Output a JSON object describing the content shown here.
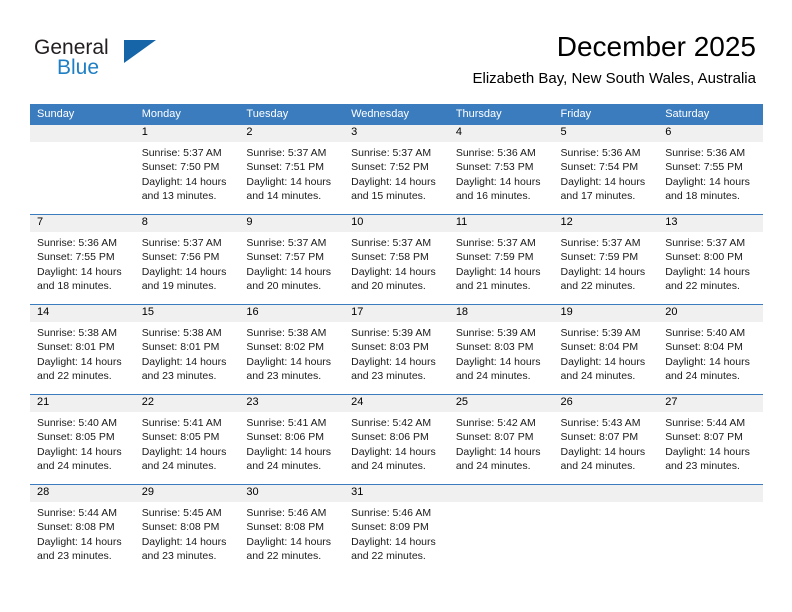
{
  "logo": {
    "word_top": "General",
    "word_bottom": "Blue",
    "triangle_color": "#1565a8",
    "blue_color": "#1f7fc4"
  },
  "header": {
    "title": "December 2025",
    "subtitle": "Elizabeth Bay, New South Wales, Australia"
  },
  "theme": {
    "header_blue": "#3b7cbf",
    "daynum_band": "#f0f0f0"
  },
  "weekdays": [
    "Sunday",
    "Monday",
    "Tuesday",
    "Wednesday",
    "Thursday",
    "Friday",
    "Saturday"
  ],
  "weeks": [
    [
      {
        "day": "",
        "lines": []
      },
      {
        "day": "1",
        "lines": [
          "Sunrise: 5:37 AM",
          "Sunset: 7:50 PM",
          "Daylight: 14 hours",
          "and 13 minutes."
        ]
      },
      {
        "day": "2",
        "lines": [
          "Sunrise: 5:37 AM",
          "Sunset: 7:51 PM",
          "Daylight: 14 hours",
          "and 14 minutes."
        ]
      },
      {
        "day": "3",
        "lines": [
          "Sunrise: 5:37 AM",
          "Sunset: 7:52 PM",
          "Daylight: 14 hours",
          "and 15 minutes."
        ]
      },
      {
        "day": "4",
        "lines": [
          "Sunrise: 5:36 AM",
          "Sunset: 7:53 PM",
          "Daylight: 14 hours",
          "and 16 minutes."
        ]
      },
      {
        "day": "5",
        "lines": [
          "Sunrise: 5:36 AM",
          "Sunset: 7:54 PM",
          "Daylight: 14 hours",
          "and 17 minutes."
        ]
      },
      {
        "day": "6",
        "lines": [
          "Sunrise: 5:36 AM",
          "Sunset: 7:55 PM",
          "Daylight: 14 hours",
          "and 18 minutes."
        ]
      }
    ],
    [
      {
        "day": "7",
        "lines": [
          "Sunrise: 5:36 AM",
          "Sunset: 7:55 PM",
          "Daylight: 14 hours",
          "and 18 minutes."
        ]
      },
      {
        "day": "8",
        "lines": [
          "Sunrise: 5:37 AM",
          "Sunset: 7:56 PM",
          "Daylight: 14 hours",
          "and 19 minutes."
        ]
      },
      {
        "day": "9",
        "lines": [
          "Sunrise: 5:37 AM",
          "Sunset: 7:57 PM",
          "Daylight: 14 hours",
          "and 20 minutes."
        ]
      },
      {
        "day": "10",
        "lines": [
          "Sunrise: 5:37 AM",
          "Sunset: 7:58 PM",
          "Daylight: 14 hours",
          "and 20 minutes."
        ]
      },
      {
        "day": "11",
        "lines": [
          "Sunrise: 5:37 AM",
          "Sunset: 7:59 PM",
          "Daylight: 14 hours",
          "and 21 minutes."
        ]
      },
      {
        "day": "12",
        "lines": [
          "Sunrise: 5:37 AM",
          "Sunset: 7:59 PM",
          "Daylight: 14 hours",
          "and 22 minutes."
        ]
      },
      {
        "day": "13",
        "lines": [
          "Sunrise: 5:37 AM",
          "Sunset: 8:00 PM",
          "Daylight: 14 hours",
          "and 22 minutes."
        ]
      }
    ],
    [
      {
        "day": "14",
        "lines": [
          "Sunrise: 5:38 AM",
          "Sunset: 8:01 PM",
          "Daylight: 14 hours",
          "and 22 minutes."
        ]
      },
      {
        "day": "15",
        "lines": [
          "Sunrise: 5:38 AM",
          "Sunset: 8:01 PM",
          "Daylight: 14 hours",
          "and 23 minutes."
        ]
      },
      {
        "day": "16",
        "lines": [
          "Sunrise: 5:38 AM",
          "Sunset: 8:02 PM",
          "Daylight: 14 hours",
          "and 23 minutes."
        ]
      },
      {
        "day": "17",
        "lines": [
          "Sunrise: 5:39 AM",
          "Sunset: 8:03 PM",
          "Daylight: 14 hours",
          "and 23 minutes."
        ]
      },
      {
        "day": "18",
        "lines": [
          "Sunrise: 5:39 AM",
          "Sunset: 8:03 PM",
          "Daylight: 14 hours",
          "and 24 minutes."
        ]
      },
      {
        "day": "19",
        "lines": [
          "Sunrise: 5:39 AM",
          "Sunset: 8:04 PM",
          "Daylight: 14 hours",
          "and 24 minutes."
        ]
      },
      {
        "day": "20",
        "lines": [
          "Sunrise: 5:40 AM",
          "Sunset: 8:04 PM",
          "Daylight: 14 hours",
          "and 24 minutes."
        ]
      }
    ],
    [
      {
        "day": "21",
        "lines": [
          "Sunrise: 5:40 AM",
          "Sunset: 8:05 PM",
          "Daylight: 14 hours",
          "and 24 minutes."
        ]
      },
      {
        "day": "22",
        "lines": [
          "Sunrise: 5:41 AM",
          "Sunset: 8:05 PM",
          "Daylight: 14 hours",
          "and 24 minutes."
        ]
      },
      {
        "day": "23",
        "lines": [
          "Sunrise: 5:41 AM",
          "Sunset: 8:06 PM",
          "Daylight: 14 hours",
          "and 24 minutes."
        ]
      },
      {
        "day": "24",
        "lines": [
          "Sunrise: 5:42 AM",
          "Sunset: 8:06 PM",
          "Daylight: 14 hours",
          "and 24 minutes."
        ]
      },
      {
        "day": "25",
        "lines": [
          "Sunrise: 5:42 AM",
          "Sunset: 8:07 PM",
          "Daylight: 14 hours",
          "and 24 minutes."
        ]
      },
      {
        "day": "26",
        "lines": [
          "Sunrise: 5:43 AM",
          "Sunset: 8:07 PM",
          "Daylight: 14 hours",
          "and 24 minutes."
        ]
      },
      {
        "day": "27",
        "lines": [
          "Sunrise: 5:44 AM",
          "Sunset: 8:07 PM",
          "Daylight: 14 hours",
          "and 23 minutes."
        ]
      }
    ],
    [
      {
        "day": "28",
        "lines": [
          "Sunrise: 5:44 AM",
          "Sunset: 8:08 PM",
          "Daylight: 14 hours",
          "and 23 minutes."
        ]
      },
      {
        "day": "29",
        "lines": [
          "Sunrise: 5:45 AM",
          "Sunset: 8:08 PM",
          "Daylight: 14 hours",
          "and 23 minutes."
        ]
      },
      {
        "day": "30",
        "lines": [
          "Sunrise: 5:46 AM",
          "Sunset: 8:08 PM",
          "Daylight: 14 hours",
          "and 22 minutes."
        ]
      },
      {
        "day": "31",
        "lines": [
          "Sunrise: 5:46 AM",
          "Sunset: 8:09 PM",
          "Daylight: 14 hours",
          "and 22 minutes."
        ]
      },
      {
        "day": "",
        "lines": []
      },
      {
        "day": "",
        "lines": []
      },
      {
        "day": "",
        "lines": []
      }
    ]
  ]
}
